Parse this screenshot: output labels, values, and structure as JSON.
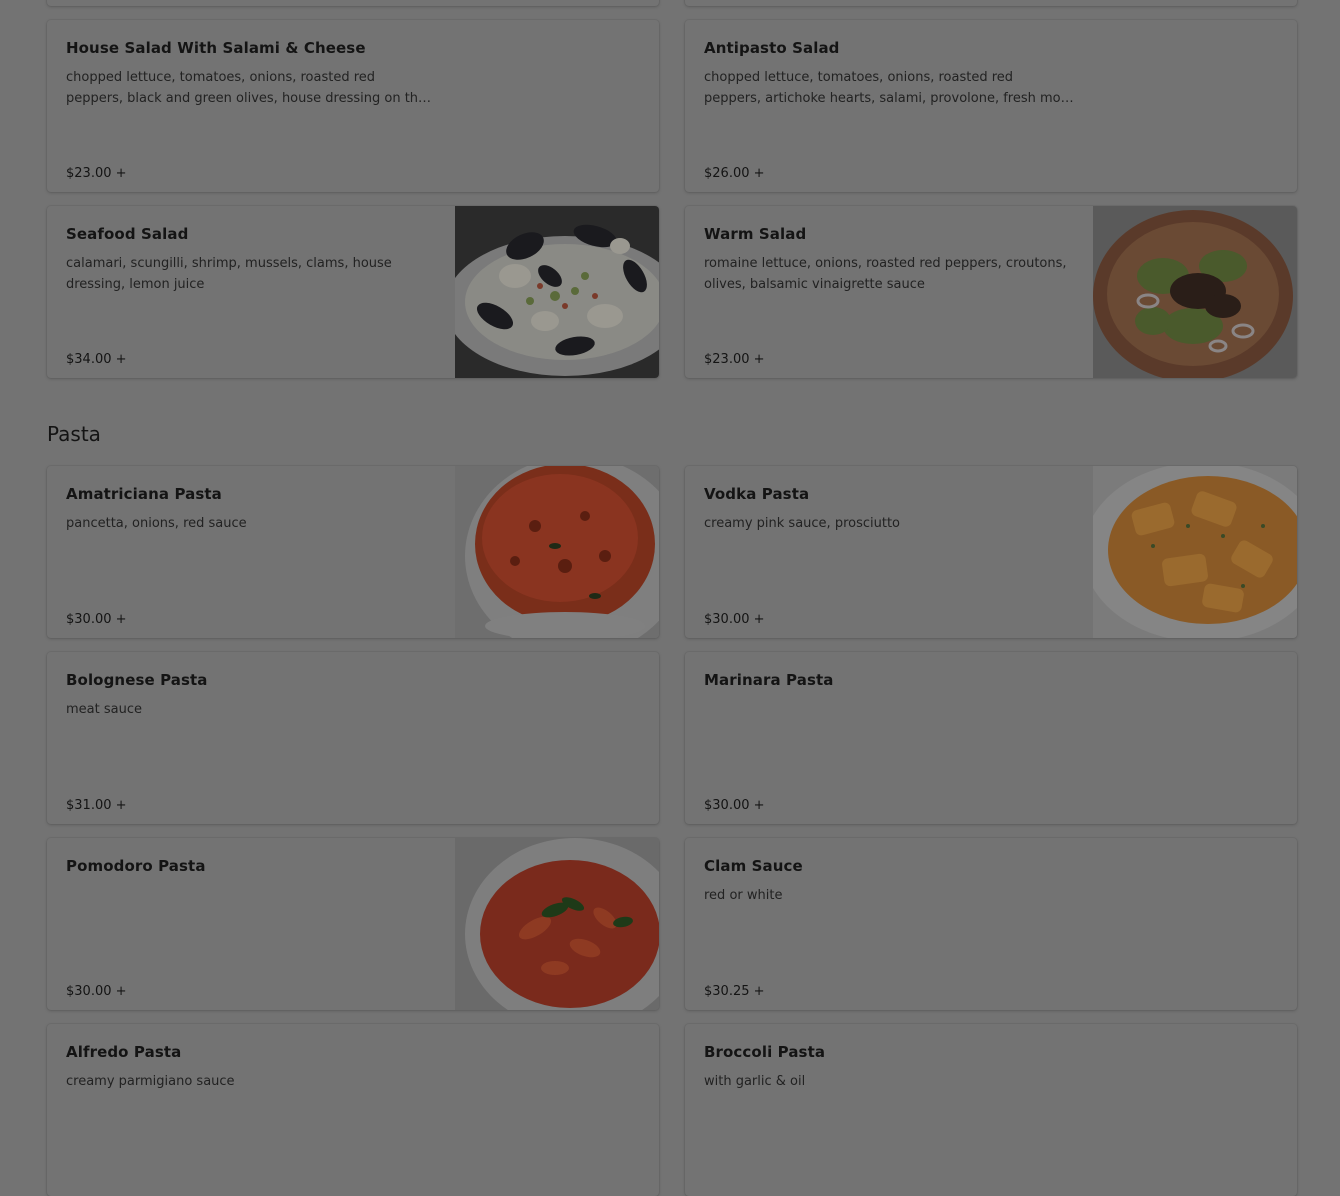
{
  "sections": {
    "pasta_title": "Pasta"
  },
  "items": {
    "house_salad": {
      "name": "House Salad With Salami & Cheese",
      "description": "chopped lettuce, tomatoes, onions, roasted red peppers, black and green olives, house dressing on th…",
      "price": "$23.00 +"
    },
    "antipasto_salad": {
      "name": "Antipasto Salad",
      "description": "chopped lettuce, tomatoes, onions, roasted red peppers, artichoke hearts, salami, provolone, fresh mo…",
      "price": "$26.00 +"
    },
    "seafood_salad": {
      "name": "Seafood Salad",
      "description": "calamari, scungilli, shrimp, mussels, clams, house dressing, lemon juice",
      "price": "$34.00 +"
    },
    "warm_salad": {
      "name": "Warm Salad",
      "description": "romaine lettuce, onions, roasted red peppers, croutons, olives, balsamic vinaigrette sauce",
      "price": "$23.00 +"
    },
    "amatriciana_pasta": {
      "name": "Amatriciana Pasta",
      "description": "pancetta, onions, red sauce",
      "price": "$30.00 +"
    },
    "vodka_pasta": {
      "name": "Vodka Pasta",
      "description": "creamy pink sauce, prosciutto",
      "price": "$30.00 +"
    },
    "bolognese_pasta": {
      "name": "Bolognese Pasta",
      "description": "meat sauce",
      "price": "$31.00 +"
    },
    "marinara_pasta": {
      "name": "Marinara Pasta",
      "description": "",
      "price": "$30.00 +"
    },
    "pomodoro_pasta": {
      "name": "Pomodoro Pasta",
      "description": "",
      "price": "$30.00 +"
    },
    "clam_sauce": {
      "name": "Clam Sauce",
      "description": "red or white",
      "price": "$30.25 +"
    },
    "alfredo_pasta": {
      "name": "Alfredo Pasta",
      "description": "creamy parmigiano sauce",
      "price": ""
    },
    "broccoli_pasta": {
      "name": "Broccoli Pasta",
      "description": "with garlic & oil",
      "price": ""
    }
  },
  "images": {
    "seafood_salad": "seafood-salad-photo",
    "warm_salad": "warm-salad-photo",
    "amatriciana_pasta": "amatriciana-pasta-photo",
    "vodka_pasta": "vodka-pasta-photo",
    "pomodoro_pasta": "pomodoro-pasta-photo"
  },
  "theme": {
    "overlay_background": "#737373",
    "text": "#141414"
  }
}
